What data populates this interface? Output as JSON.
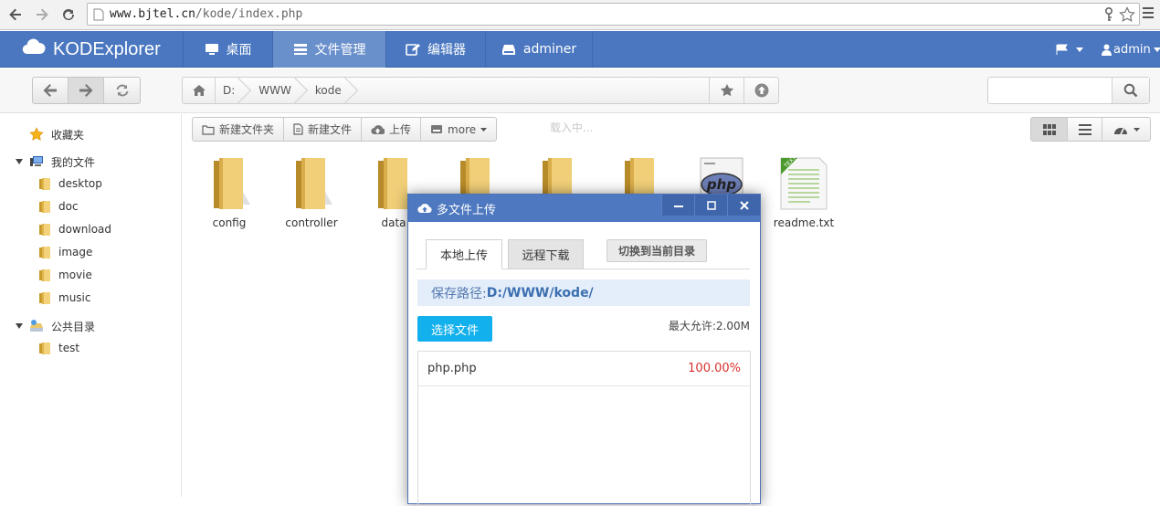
{
  "browser": {
    "url_host": "www.bjtel.cn",
    "url_path": "/kode/index.php"
  },
  "app": {
    "brand": "KODExplorer",
    "nav": [
      {
        "label": "桌面",
        "icon": "monitor-icon"
      },
      {
        "label": "文件管理",
        "icon": "file-manager-icon"
      },
      {
        "label": "编辑器",
        "icon": "edit-icon"
      },
      {
        "label": "adminer",
        "icon": "hdd-icon"
      }
    ],
    "user": "admin",
    "accent": "#4a77c0"
  },
  "breadcrumb": [
    "D:",
    "WWW",
    "kode"
  ],
  "sidebar": {
    "favorites": "收藏夹",
    "my_files": "我的文件",
    "folders": [
      "desktop",
      "doc",
      "download",
      "image",
      "movie",
      "music"
    ],
    "public": "公共目录",
    "public_folders": [
      "test"
    ]
  },
  "file_toolbar": {
    "new_folder": "新建文件夹",
    "new_file": "新建文件",
    "upload": "上传",
    "more": "more",
    "loading": "载入中..."
  },
  "files": [
    {
      "name": "config",
      "type": "folder"
    },
    {
      "name": "controller",
      "type": "folder"
    },
    {
      "name": "data",
      "type": "folder"
    },
    {
      "name": "",
      "type": "folder"
    },
    {
      "name": "",
      "type": "folder"
    },
    {
      "name": "",
      "type": "folder"
    },
    {
      "name": "",
      "type": "php"
    },
    {
      "name": "readme.txt",
      "type": "txt"
    }
  ],
  "dialog": {
    "title": "多文件上传",
    "tabs": [
      "本地上传",
      "远程下载"
    ],
    "switch_button": "切换到当前目录",
    "save_path_label": "保存路径:",
    "save_path": "D:/WWW/kode/",
    "choose_button": "选择文件",
    "max_size": "最大允许:2.00M",
    "uploads": [
      {
        "name": "php.php",
        "progress": "100.00%"
      }
    ]
  }
}
